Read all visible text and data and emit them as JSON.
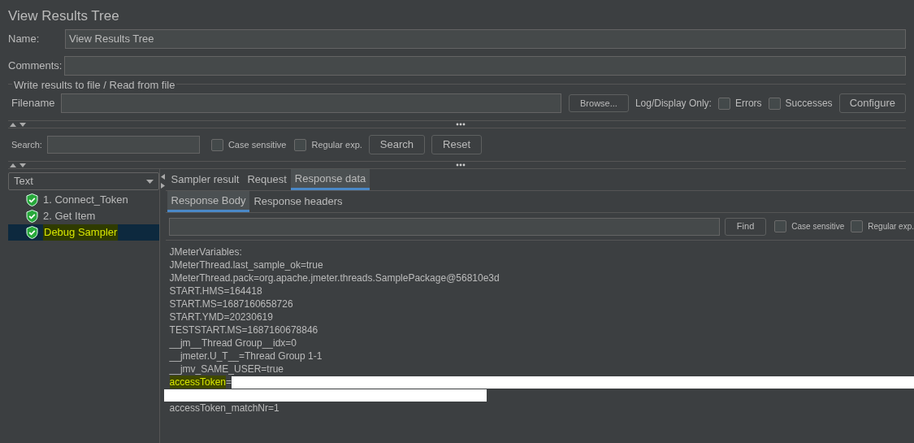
{
  "title": "View Results Tree",
  "name": {
    "label": "Name:",
    "value": "View Results Tree"
  },
  "comments": {
    "label": "Comments:"
  },
  "file_group": {
    "title": "Write results to file / Read from file",
    "filename_label": "Filename",
    "browse_button": "Browse...",
    "log_label": "Log/Display Only:",
    "errors": {
      "label": "Errors",
      "checked": false
    },
    "successes": {
      "label": "Successes",
      "checked": false
    },
    "configure_button": "Configure"
  },
  "search": {
    "label": "Search:",
    "case_sensitive": {
      "label": "Case sensitive",
      "checked": false
    },
    "regex": {
      "label": "Regular exp.",
      "checked": false
    },
    "search_button": "Search",
    "reset_button": "Reset"
  },
  "renderer": {
    "value": "Text"
  },
  "results": [
    {
      "label": "1. Connect_Token",
      "selected": false
    },
    {
      "label": "2. Get Item",
      "selected": false
    },
    {
      "label": "Debug Sampler",
      "selected": true
    }
  ],
  "tabs": [
    {
      "label": "Sampler result",
      "selected": false
    },
    {
      "label": "Request",
      "selected": false
    },
    {
      "label": "Response data",
      "selected": true
    }
  ],
  "subtabs": [
    {
      "label": "Response Body",
      "selected": true
    },
    {
      "label": "Response headers",
      "selected": false
    }
  ],
  "find": {
    "button": "Find",
    "case_sensitive": {
      "label": "Case sensitive",
      "checked": false
    },
    "regex": {
      "label": "Regular exp.",
      "checked": false
    }
  },
  "response_lines": [
    {
      "kind": "text",
      "text": "JMeterVariables:"
    },
    {
      "kind": "text",
      "text": "JMeterThread.last_sample_ok=true"
    },
    {
      "kind": "text",
      "text": "JMeterThread.pack=org.apache.jmeter.threads.SamplePackage@56810e3d"
    },
    {
      "kind": "text",
      "text": "START.HMS=164418"
    },
    {
      "kind": "text",
      "text": "START.MS=1687160658726"
    },
    {
      "kind": "text",
      "text": "START.YMD=20230619"
    },
    {
      "kind": "text",
      "text": "TESTSTART.MS=1687160678846"
    },
    {
      "kind": "text",
      "text": "__jm__Thread Group__idx=0"
    },
    {
      "kind": "text",
      "text": "__jmeter.U_T__=Thread Group 1-1"
    },
    {
      "kind": "text",
      "text": "__jmv_SAME_USER=true"
    },
    {
      "kind": "match",
      "match": "accessToken",
      "text": "="
    },
    {
      "kind": "redacted"
    },
    {
      "kind": "text",
      "text": "accessToken_matchNr=1"
    }
  ]
}
